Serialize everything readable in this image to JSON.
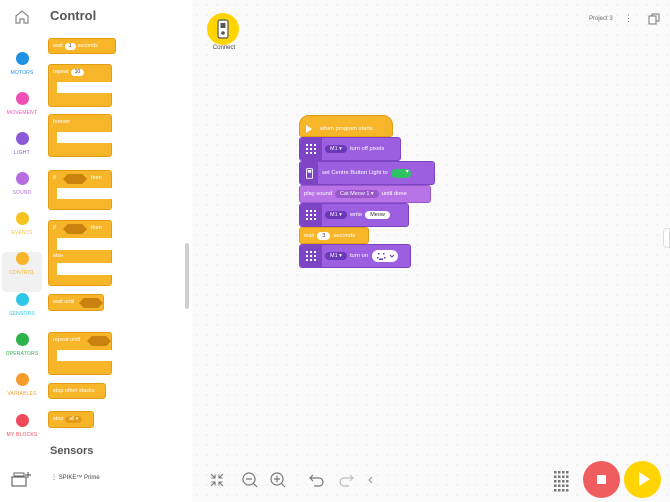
{
  "palette": {
    "title": "Control",
    "next_section": "Sensors"
  },
  "categories": [
    {
      "label": "MOTORS",
      "color": "#1e90e6"
    },
    {
      "label": "MOVEMENT",
      "color": "#f04fb4"
    },
    {
      "label": "LIGHT",
      "color": "#8a5ad8"
    },
    {
      "label": "SOUND",
      "color": "#b86ce0"
    },
    {
      "label": "EVENTS",
      "color": "#f7c41f"
    },
    {
      "label": "CONTROL",
      "color": "#f7b529"
    },
    {
      "label": "SENSORS",
      "color": "#2ec7e8"
    },
    {
      "label": "OPERATORS",
      "color": "#2eb34a"
    },
    {
      "label": "VARIABLES",
      "color": "#f39c2b"
    },
    {
      "label": "MY BLOCKS",
      "color": "#ef4a5a"
    }
  ],
  "palette_blocks": {
    "wait": {
      "label": "wait",
      "value": "1",
      "suffix": "seconds"
    },
    "repeat": {
      "label": "repeat",
      "value": "10"
    },
    "forever": {
      "label": "forever"
    },
    "if_then": {
      "if": "if",
      "then": "then"
    },
    "if_else": {
      "if": "if",
      "then": "then",
      "else": "else"
    },
    "wait_until": {
      "label": "wait until"
    },
    "repeat_until": {
      "label": "repeat until"
    },
    "stop_other": {
      "label": "stop other stacks"
    },
    "stop": {
      "label": "stop",
      "value": "all"
    }
  },
  "hub": {
    "label": "Connect",
    "select_label": "SPIKE™ Prime"
  },
  "project": {
    "name": "Project 3"
  },
  "program": {
    "hat": "when program starts",
    "b1": {
      "port": "M1",
      "text": "turn off pixels"
    },
    "b2": {
      "text": "set Centre Button Light to"
    },
    "b3": {
      "text": "play sound",
      "sound": "Cat Meow 1",
      "suffix": "until done"
    },
    "b4": {
      "port": "M1",
      "text": "write",
      "value": "Meow"
    },
    "b5": {
      "text": "wait",
      "value": "3",
      "suffix": "seconds"
    },
    "b6": {
      "port": "M1",
      "text": "turn on"
    }
  }
}
